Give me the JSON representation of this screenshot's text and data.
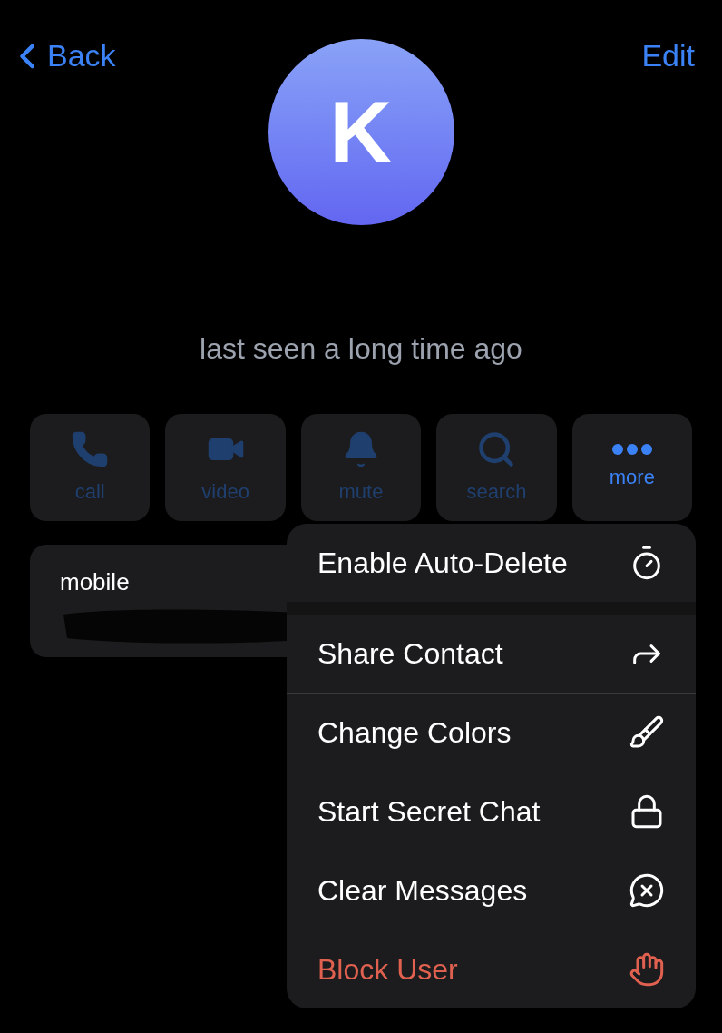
{
  "nav": {
    "back": "Back",
    "edit": "Edit"
  },
  "avatar": {
    "initial": "K"
  },
  "status": "last seen a long time ago",
  "actions": [
    {
      "label": "call",
      "disabled": true
    },
    {
      "label": "video",
      "disabled": true
    },
    {
      "label": "mute",
      "disabled": true
    },
    {
      "label": "search",
      "disabled": true
    },
    {
      "label": "more",
      "disabled": false
    }
  ],
  "phone": {
    "label": "mobile"
  },
  "menu": [
    {
      "label": "Enable Auto-Delete",
      "kind": "normal"
    },
    {
      "label": "Share Contact",
      "kind": "normal"
    },
    {
      "label": "Change Colors",
      "kind": "normal"
    },
    {
      "label": "Start Secret Chat",
      "kind": "normal"
    },
    {
      "label": "Clear Messages",
      "kind": "normal"
    },
    {
      "label": "Block User",
      "kind": "destructive"
    }
  ]
}
